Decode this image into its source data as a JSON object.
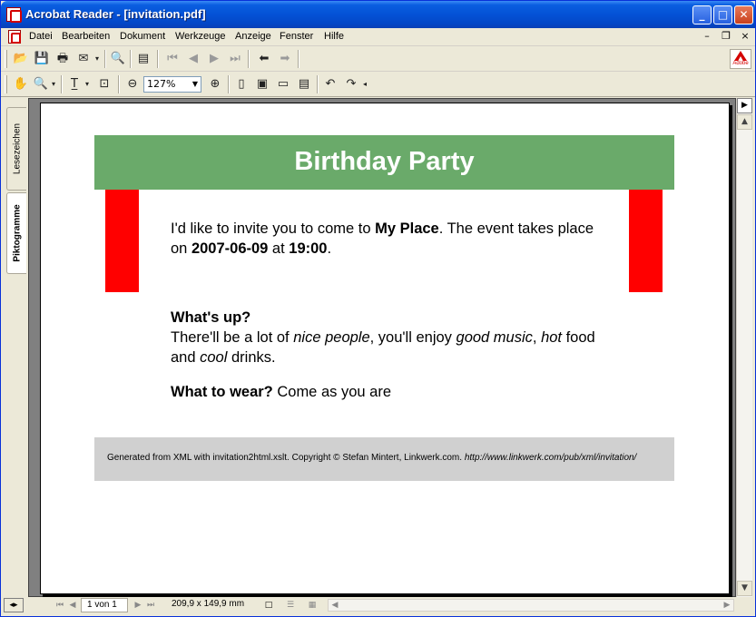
{
  "window": {
    "title": "Acrobat Reader - [invitation.pdf]",
    "minimize": "_",
    "maximize": "□",
    "close": "✕"
  },
  "menubar": {
    "items": [
      "Datei",
      "Bearbeiten",
      "Dokument",
      "Werkzeuge",
      "Anzeige",
      "Fenster",
      "Hilfe"
    ],
    "mdi_minimize": "–",
    "mdi_restore": "❐",
    "mdi_close": "×"
  },
  "toolbar": {
    "zoom_value": "127%",
    "adobe_label": "Adobe"
  },
  "nav_tabs": {
    "bookmarks": "Lesezeichen",
    "thumbnails": "Piktogramme"
  },
  "document": {
    "banner_title": "Birthday Party",
    "intro": {
      "text1": "I'd like to invite you to come to ",
      "place": "My Place",
      "text2": ". The event takes place on ",
      "date": "2007-06-09",
      "text3": " at ",
      "time": "19:00",
      "text4": "."
    },
    "whatsup": {
      "heading": "What's up?",
      "t1": "There'll be a lot of ",
      "nice_people": "nice people",
      "t2": ", you'll enjoy ",
      "good_music": "good music",
      "t3": ", ",
      "hot": "hot",
      "t4": " food and ",
      "cool": "cool",
      "t5": " drinks."
    },
    "wear": {
      "heading": "What to wear?",
      "text": " Come as you are"
    },
    "footer": {
      "text": "Generated from XML with invitation2html.xslt. Copyright © Stefan Mintert, Linkwerk.com. ",
      "url": "http://www.linkwerk.com/pub/xml/invitation/"
    }
  },
  "statusbar": {
    "page_indicator": "1 von 1",
    "page_size": "209,9 x 149,9 mm"
  },
  "colors": {
    "banner": "#6aaa6a",
    "pillars": "#ff0000",
    "footer_bg": "#d0d0d0",
    "titlebar": "#0452d6"
  }
}
